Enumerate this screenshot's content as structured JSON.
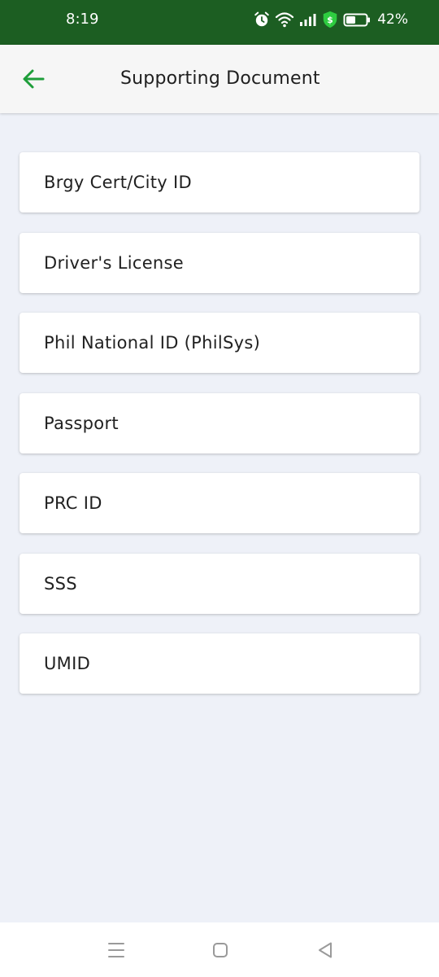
{
  "status_bar": {
    "time": "8:19",
    "battery_percent": "42%",
    "icons": [
      "alarm-icon",
      "wifi-icon",
      "signal-icon",
      "security-shield-icon",
      "battery-icon"
    ]
  },
  "header": {
    "title": "Supporting Document",
    "back_icon": "arrow-left-icon",
    "accent_color": "#1e9e3a"
  },
  "documents": [
    {
      "label": "Brgy Cert/City ID"
    },
    {
      "label": "Driver's License"
    },
    {
      "label": "Phil National ID (PhilSys)"
    },
    {
      "label": "Passport"
    },
    {
      "label": "PRC ID"
    },
    {
      "label": "SSS"
    },
    {
      "label": "UMID"
    }
  ],
  "nav_bar": {
    "icons": [
      "menu-icon",
      "home-icon",
      "back-icon"
    ]
  },
  "colors": {
    "status_bar": "#1c5e22",
    "background": "#eef1f8",
    "card": "#ffffff",
    "text": "#212121"
  }
}
